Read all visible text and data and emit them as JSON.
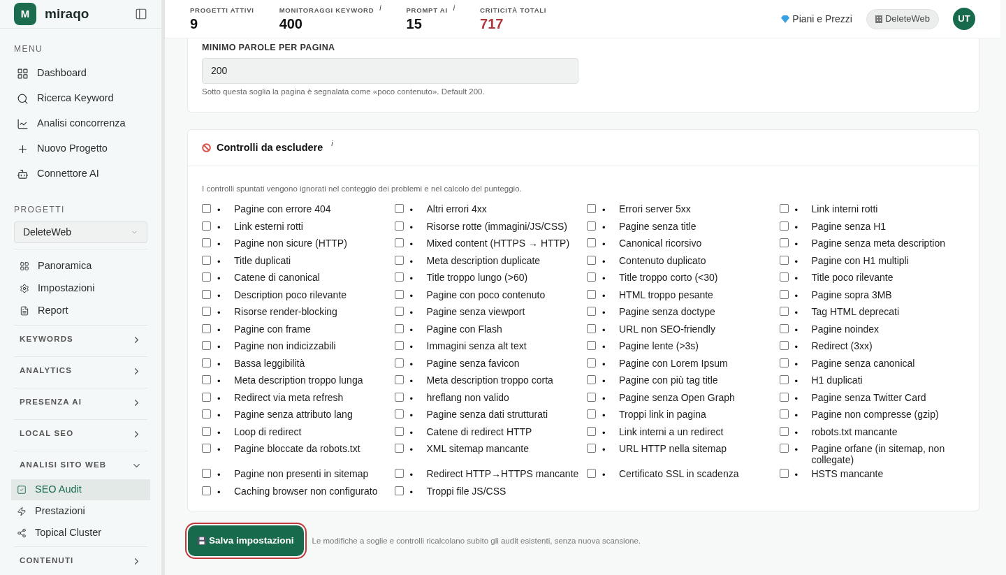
{
  "brand": {
    "logo_letter": "M",
    "name": "miraqo"
  },
  "sidebar": {
    "menu_title": "MENU",
    "menu": [
      {
        "label": "Dashboard"
      },
      {
        "label": "Ricerca Keyword"
      },
      {
        "label": "Analisi concorrenza"
      },
      {
        "label": "Nuovo Progetto"
      },
      {
        "label": "Connettore AI"
      }
    ],
    "projects_title": "PROGETTI",
    "project_select": {
      "value": "DeleteWeb"
    },
    "project_links": [
      {
        "label": "Panoramica"
      },
      {
        "label": "Impostazioni"
      },
      {
        "label": "Report"
      }
    ],
    "sections": [
      {
        "title": "KEYWORDS",
        "expanded": false
      },
      {
        "title": "ANALYTICS",
        "expanded": false
      },
      {
        "title": "PRESENZA AI",
        "expanded": false
      },
      {
        "title": "LOCAL SEO",
        "expanded": false
      },
      {
        "title": "ANALISI SITO WEB",
        "expanded": true,
        "items": [
          {
            "label": "SEO Audit",
            "selected": true
          },
          {
            "label": "Prestazioni",
            "selected": false
          },
          {
            "label": "Topical Cluster",
            "selected": false
          }
        ]
      },
      {
        "title": "CONTENUTI",
        "expanded": false
      }
    ]
  },
  "header": {
    "stats": [
      {
        "label": "PROGETTI ATTIVI",
        "value": "9",
        "alert": false
      },
      {
        "label": "MONITORAGGI KEYWORD",
        "value": "400",
        "info": "i",
        "alert": false
      },
      {
        "label": "PROMPT AI",
        "value": "15",
        "info": "i",
        "alert": false
      },
      {
        "label": "CRITICITÀ TOTALI",
        "value": "717",
        "alert": true
      }
    ],
    "plans_link": "Piani e Prezzi",
    "workspace": "DeleteWeb",
    "avatar": "UT"
  },
  "min_words": {
    "label": "MINIMO PAROLE PER PAGINA",
    "value": "200",
    "help": "Sotto questa soglia la pagina è segnalata come «poco contenuto». Default 200."
  },
  "exclusions": {
    "title": "Controlli da escludere",
    "info": "i",
    "description": "I controlli spuntati vengono ignorati nel conteggio dei problemi e nel calcolo del punteggio.",
    "checks": [
      {
        "marker": "•",
        "label": "Pagine con errore 404",
        "checked": false
      },
      {
        "marker": "•",
        "label": "Altri errori 4xx",
        "checked": false
      },
      {
        "marker": "•",
        "label": "Errori server 5xx",
        "checked": false
      },
      {
        "marker": "•",
        "label": "Link interni rotti",
        "checked": false
      },
      {
        "marker": "•",
        "label": "Link esterni rotti",
        "checked": false
      },
      {
        "marker": "•",
        "label": "Risorse rotte (immagini/JS/CSS)",
        "checked": false
      },
      {
        "marker": "•",
        "label": "Pagine senza title",
        "checked": false
      },
      {
        "marker": "•",
        "label": "Pagine senza H1",
        "checked": false
      },
      {
        "marker": "•",
        "label": "Pagine non sicure (HTTP)",
        "checked": false
      },
      {
        "marker": "•",
        "label": "Mixed content (HTTPS → HTTP)",
        "checked": false
      },
      {
        "marker": "•",
        "label": "Canonical ricorsivo",
        "checked": false
      },
      {
        "marker": "•",
        "label": "Pagine senza meta description",
        "checked": false
      },
      {
        "marker": "•",
        "label": "Title duplicati",
        "checked": false
      },
      {
        "marker": "•",
        "label": "Meta description duplicate",
        "checked": false
      },
      {
        "marker": "•",
        "label": "Contenuto duplicato",
        "checked": false
      },
      {
        "marker": "•",
        "label": "Pagine con H1 multipli",
        "checked": false
      },
      {
        "marker": "•",
        "label": "Catene di canonical",
        "checked": false
      },
      {
        "marker": "•",
        "label": "Title troppo lungo (>60)",
        "checked": false
      },
      {
        "marker": "•",
        "label": "Title troppo corto (<30)",
        "checked": false
      },
      {
        "marker": "•",
        "label": "Title poco rilevante",
        "checked": false
      },
      {
        "marker": "•",
        "label": "Description poco rilevante",
        "checked": false
      },
      {
        "marker": "•",
        "label": "Pagine con poco contenuto",
        "checked": false
      },
      {
        "marker": "•",
        "label": "HTML troppo pesante",
        "checked": false
      },
      {
        "marker": "•",
        "label": "Pagine sopra 3MB",
        "checked": false
      },
      {
        "marker": "•",
        "label": "Risorse render-blocking",
        "checked": false
      },
      {
        "marker": "•",
        "label": "Pagine senza viewport",
        "checked": false
      },
      {
        "marker": "•",
        "label": "Pagine senza doctype",
        "checked": false
      },
      {
        "marker": "•",
        "label": "Tag HTML deprecati",
        "checked": false
      },
      {
        "marker": "•",
        "label": "Pagine con frame",
        "checked": false
      },
      {
        "marker": "•",
        "label": "Pagine con Flash",
        "checked": false
      },
      {
        "marker": "•",
        "label": "URL non SEO-friendly",
        "checked": false
      },
      {
        "marker": "•",
        "label": "Pagine noindex",
        "checked": false
      },
      {
        "marker": "•",
        "label": "Pagine non indicizzabili",
        "checked": false
      },
      {
        "marker": "•",
        "label": "Immagini senza alt text",
        "checked": false
      },
      {
        "marker": "•",
        "label": "Pagine lente (>3s)",
        "checked": false
      },
      {
        "marker": "•",
        "label": "Redirect (3xx)",
        "checked": false
      },
      {
        "marker": "•",
        "label": "Bassa leggibilità",
        "checked": false
      },
      {
        "marker": "•",
        "label": "Pagine senza favicon",
        "checked": false
      },
      {
        "marker": "•",
        "label": "Pagine con Lorem Ipsum",
        "checked": false
      },
      {
        "marker": "•",
        "label": "Pagine senza canonical",
        "checked": false
      },
      {
        "marker": "•",
        "label": "Meta description troppo lunga",
        "checked": false
      },
      {
        "marker": "•",
        "label": "Meta description troppo corta",
        "checked": false
      },
      {
        "marker": "•",
        "label": "Pagine con più tag title",
        "checked": false
      },
      {
        "marker": "•",
        "label": "H1 duplicati",
        "checked": false
      },
      {
        "marker": "•",
        "label": "Redirect via meta refresh",
        "checked": false
      },
      {
        "marker": "•",
        "label": "hreflang non valido",
        "checked": false
      },
      {
        "marker": "•",
        "label": "Pagine senza Open Graph",
        "checked": false
      },
      {
        "marker": "•",
        "label": "Pagine senza Twitter Card",
        "checked": false
      },
      {
        "marker": "•",
        "label": "Pagine senza attributo lang",
        "checked": false
      },
      {
        "marker": "•",
        "label": "Pagine senza dati strutturati",
        "checked": false
      },
      {
        "marker": "•",
        "label": "Troppi link in pagina",
        "checked": false
      },
      {
        "marker": "•",
        "label": "Pagine non compresse (gzip)",
        "checked": false
      },
      {
        "marker": "•",
        "label": "Loop di redirect",
        "checked": false
      },
      {
        "marker": "•",
        "label": "Catene di redirect HTTP",
        "checked": false
      },
      {
        "marker": "•",
        "label": "Link interni a un redirect",
        "checked": false
      },
      {
        "marker": "•",
        "label": "robots.txt mancante",
        "checked": false
      },
      {
        "marker": "•",
        "label": "Pagine bloccate da robots.txt",
        "checked": false
      },
      {
        "marker": "•",
        "label": "XML sitemap mancante",
        "checked": false
      },
      {
        "marker": "•",
        "label": "URL HTTP nella sitemap",
        "checked": false
      },
      {
        "marker": "•",
        "label": "Pagine orfane (in sitemap, non collegate)",
        "checked": false
      },
      {
        "marker": "•",
        "label": "Pagine non presenti in sitemap",
        "checked": false
      },
      {
        "marker": "•",
        "label": "Redirect HTTP→HTTPS mancante",
        "checked": false
      },
      {
        "marker": "•",
        "label": "Certificato SSL in scadenza",
        "checked": false
      },
      {
        "marker": "•",
        "label": "HSTS mancante",
        "checked": false
      },
      {
        "marker": "•",
        "label": "Caching browser non configurato",
        "checked": false
      },
      {
        "marker": "•",
        "label": "Troppi file JS/CSS",
        "checked": false
      }
    ]
  },
  "save": {
    "label": "Salva impostazioni",
    "note": "Le modifiche a soglie e controlli ricalcolano subito gli audit esistenti, senza nuova scansione."
  }
}
